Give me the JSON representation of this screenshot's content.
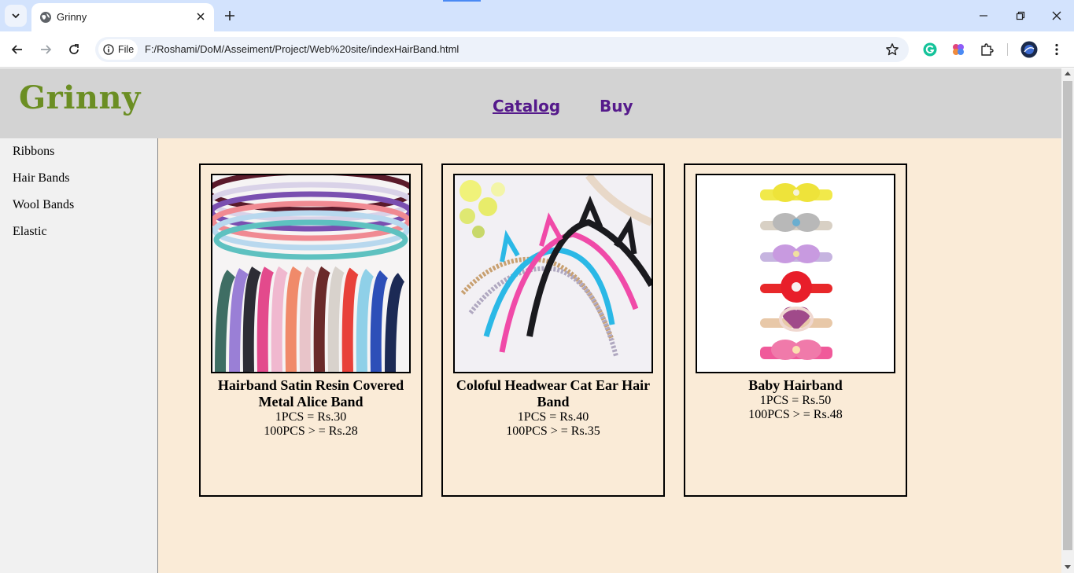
{
  "browser": {
    "tab_title": "Grinny",
    "chip_label": "File",
    "url": "F:/Roshami/DoM/Asseiment/Project/Web%20site/indexHairBand.html"
  },
  "site": {
    "logo": "Grinny",
    "nav": [
      {
        "label": "Catalog",
        "active": true
      },
      {
        "label": "Buy",
        "active": false
      }
    ],
    "sidebar": [
      "Ribbons",
      "Hair Bands",
      "Wool Bands",
      "Elastic"
    ]
  },
  "products": [
    {
      "title": "Hairband Satin Resin Covered Metal Alice Band",
      "price_single": "1PCS = Rs.30",
      "price_bulk": "100PCS > = Rs.28"
    },
    {
      "title": "Coloful Headwear Cat Ear Hair Band",
      "price_single": "1PCS = Rs.40",
      "price_bulk": "100PCS > = Rs.35"
    },
    {
      "title": "Baby Hairband",
      "price_single": "1PCS = Rs.50",
      "price_bulk": "100PCS > = Rs.48"
    }
  ],
  "colors": {
    "logo": "#6b8e23",
    "header_bg": "#d3d3d3",
    "page_bg": "#faebd7",
    "sidebar_bg": "#f1f1f1",
    "nav_link": "#551a8b"
  }
}
